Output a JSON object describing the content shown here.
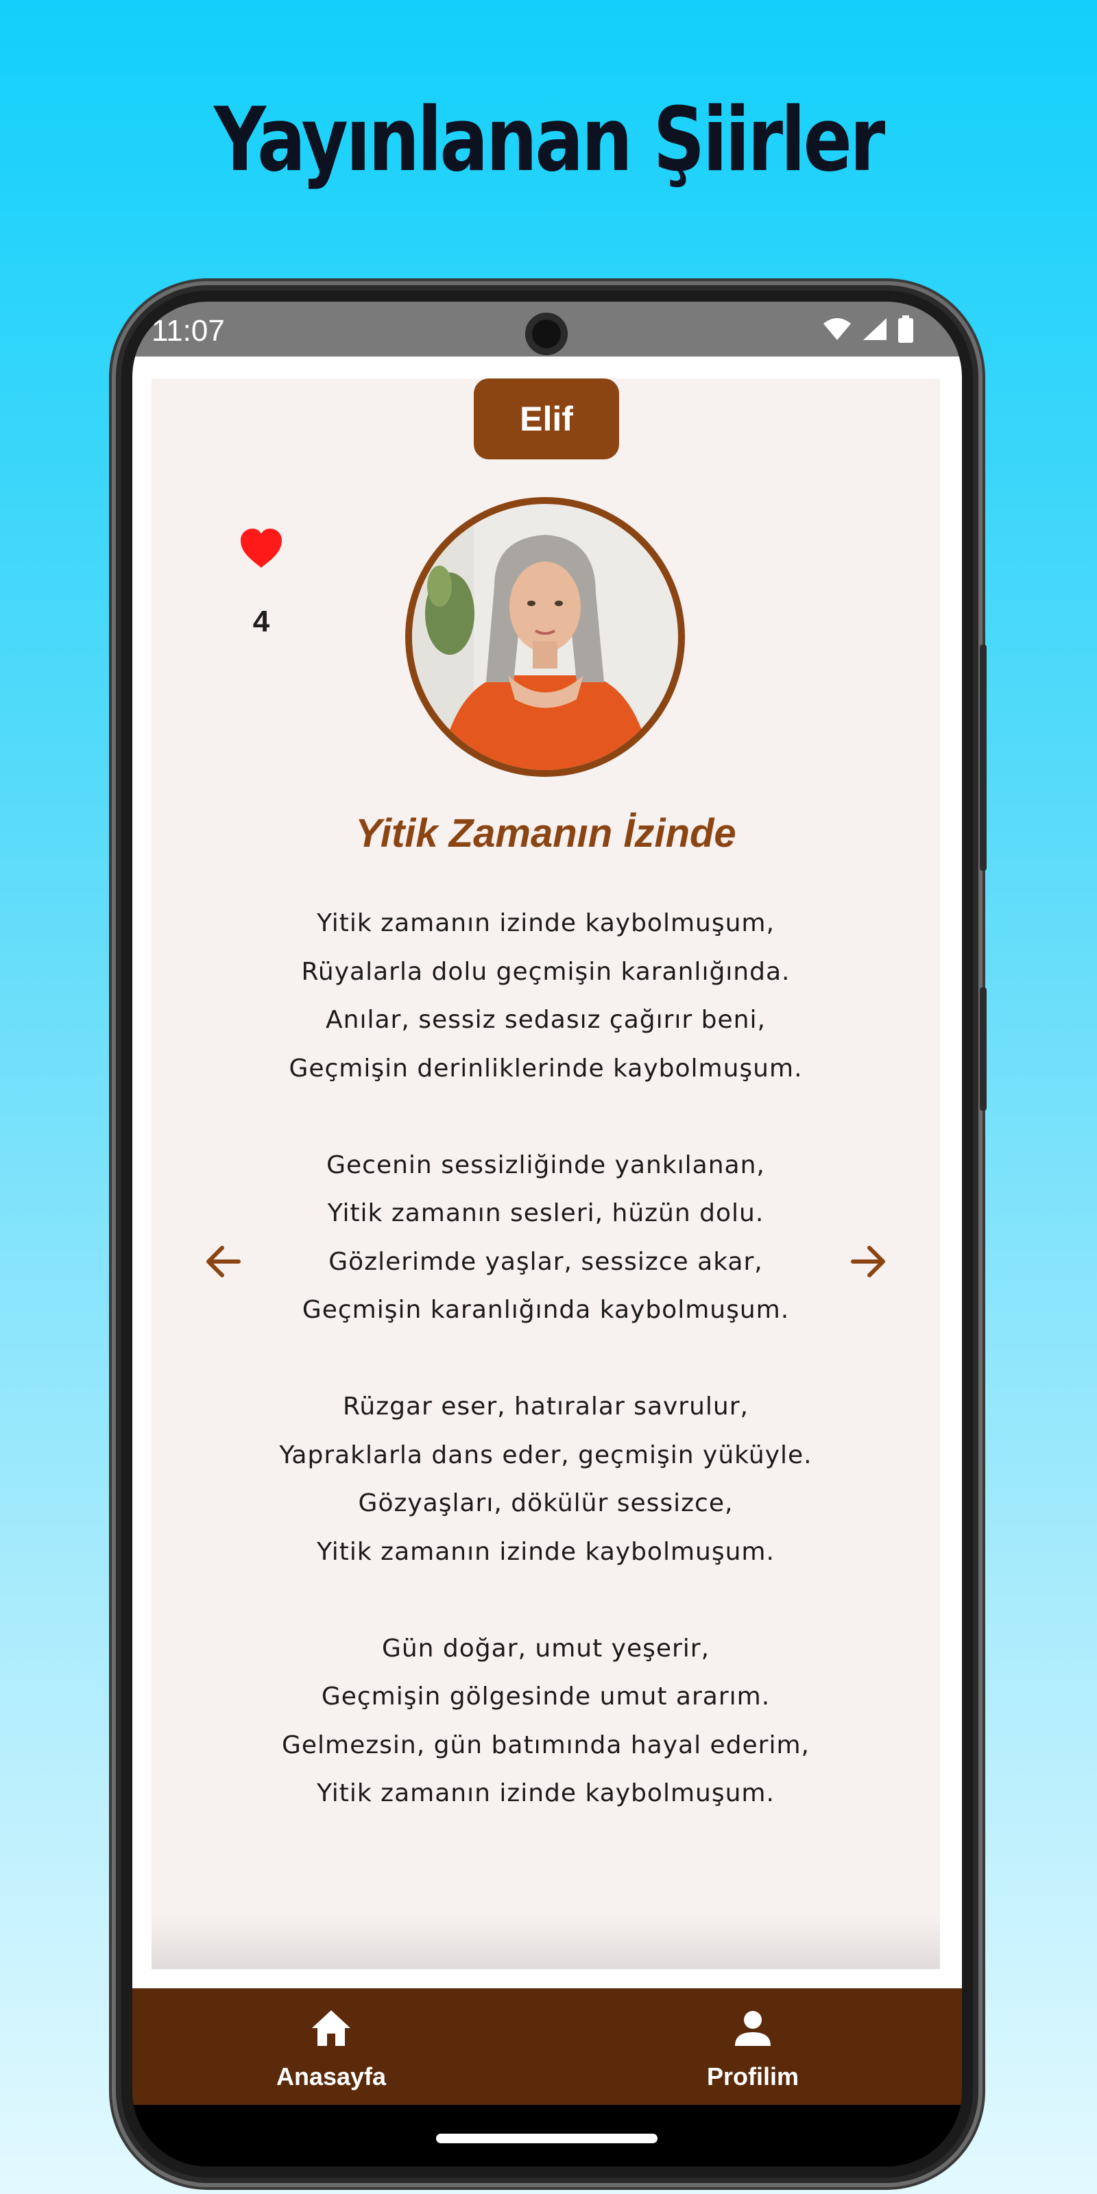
{
  "headline": "Yayınlanan Şiirler",
  "status_bar": {
    "time": "11:07",
    "icons": [
      "wifi-icon",
      "signal-icon",
      "battery-icon"
    ]
  },
  "poet": {
    "name": "Elif",
    "likes": "4",
    "avatar_icon": "poet-photo"
  },
  "poem": {
    "title": "Yitik Zamanın İzinde",
    "lines": [
      "Yitik zamanın izinde kaybolmuşum,",
      "Rüyalarla dolu geçmişin karanlığında.",
      "Anılar, sessiz sedasız çağırır beni,",
      "Geçmişin derinliklerinde kaybolmuşum.",
      "",
      "Gecenin sessizliğinde yankılanan,",
      "Yitik zamanın sesleri, hüzün dolu.",
      "Gözlerimde yaşlar, sessizce akar,",
      "Geçmişin karanlığında kaybolmuşum.",
      "",
      "Rüzgar eser, hatıralar savrulur,",
      "Yapraklarla dans eder, geçmişin yüküyle.",
      "Gözyaşları, dökülür sessizce,",
      "Yitik zamanın izinde kaybolmuşum.",
      "",
      "Gün doğar, umut yeşerir,",
      "Geçmişin gölgesinde umut ararım.",
      "Gelmezsin, gün batımında hayal ederim,",
      "Yitik zamanın izinde kaybolmuşum."
    ]
  },
  "navigation": {
    "prev_icon": "arrow-left-icon",
    "next_icon": "arrow-right-icon",
    "items": [
      {
        "label": "Anasayfa",
        "icon": "home-icon"
      },
      {
        "label": "Profilim",
        "icon": "person-icon"
      }
    ]
  },
  "colors": {
    "accent": "#8b4513",
    "nav_bar": "#5a2a0a",
    "like": "#ff1a1a",
    "card": "#f7f1f0"
  }
}
